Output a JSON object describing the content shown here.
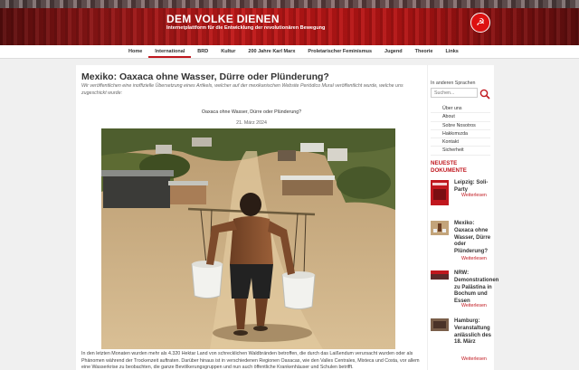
{
  "header": {
    "title": "DEM VOLKE DIENEN",
    "subtitle": "Internetplattform für die Entwicklung der revolutionären Bewegung",
    "logo_symbol": "☭"
  },
  "nav": {
    "items": [
      {
        "label": "Home"
      },
      {
        "label": "International"
      },
      {
        "label": "BRD"
      },
      {
        "label": "Kultur"
      },
      {
        "label": "200 Jahre Karl Marx"
      },
      {
        "label": "Proletarischer Feminismus"
      },
      {
        "label": "Jugend"
      },
      {
        "label": "Theorie"
      },
      {
        "label": "Links"
      }
    ]
  },
  "article": {
    "title": "Mexiko: Oaxaca ohne Wasser, Dürre oder Plünderung?",
    "intro": "Wir veröffentlichen eine inoffizielle Übersetzung eines Artikels, welcher auf der mexikanischen Website Periódico Mural veröffentlicht wurde, welche uns zugeschickt wurde:",
    "doc_title": "Oaxaca ohne Wasser, Dürre oder Plünderung?",
    "doc_date": "21. März 2024",
    "body": "In den letzten Monaten wurden mehr als 4.320 Hektar Land von schrecklichen Waldbränden betroffen, die durch das Laißendum verursacht wurden oder als Phänomen während der Trockenzeit auftraten. Darüber hinaus ist in verschiedenen Regionen Oaxacas, wie den Valles Centrales, Mixteca und Costa, vor allem eine Wasserkrise zu beobachten, die ganze Bevölkerungsgruppen und nun auch öffentliche Krankenhäuser und Schulen betrifft."
  },
  "sidebar": {
    "lang_label": "In anderen Sprachen",
    "search_placeholder": "Suchen...",
    "links": [
      {
        "label": "Über uns"
      },
      {
        "label": "About"
      },
      {
        "label": "Sobre Nosotros"
      },
      {
        "label": "Hakkımızda"
      },
      {
        "label": "Kontakt"
      },
      {
        "label": "Sicherheit"
      }
    ],
    "section_title": "NEUESTE DOKUMENTE",
    "more_label": "Weiterlesen",
    "documents": [
      {
        "title": "Leipzig: Soli-Party"
      },
      {
        "title": "Mexiko: Oaxaca ohne Wasser, Dürre oder Plünderung?"
      },
      {
        "title": "NRW: Demonstrationen zu Palästina in Bochum und Essen"
      },
      {
        "title": "Hamburg: Veranstaltung anlässlich des 18. März"
      }
    ]
  },
  "colors": {
    "accent": "#c0171e",
    "header_red": "#b31414"
  }
}
